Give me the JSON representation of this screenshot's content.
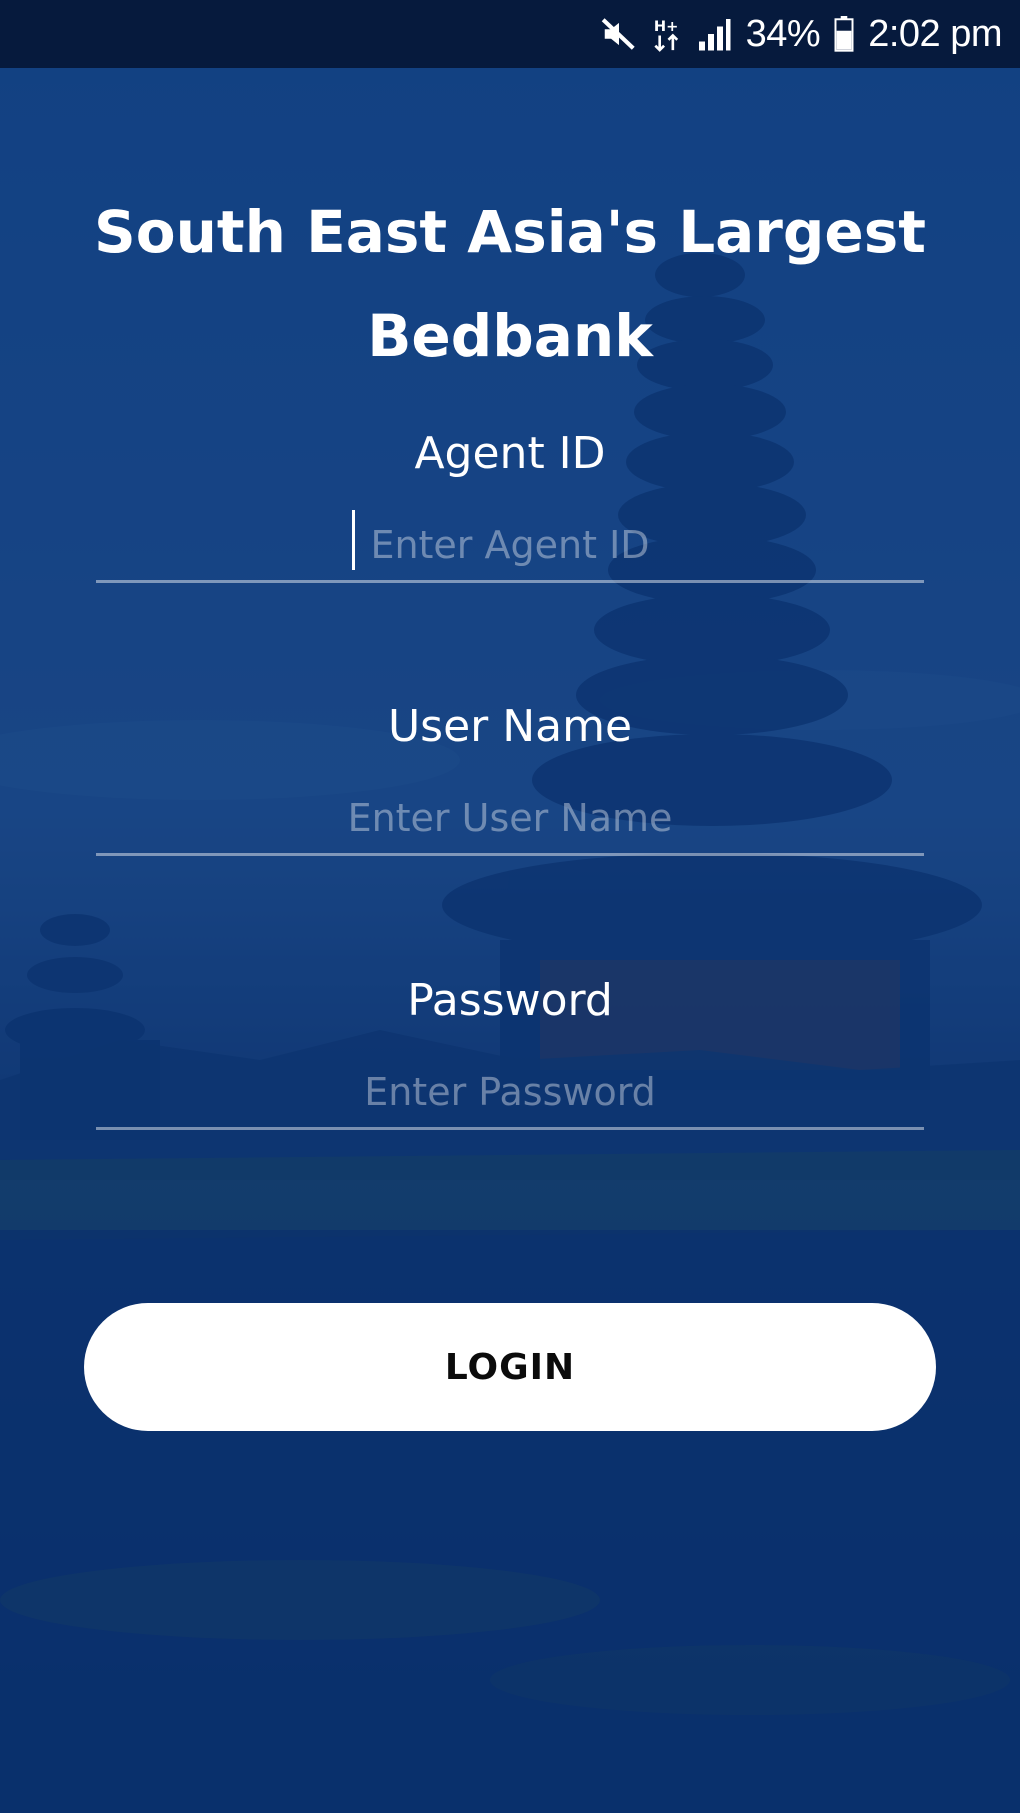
{
  "status_bar": {
    "battery": "34%",
    "time": "2:02 pm",
    "icons": [
      "mute-icon",
      "data-hplus-icon",
      "signal-icon",
      "battery-icon"
    ]
  },
  "login": {
    "title": "South East Asia's Largest Bedbank",
    "agent_id": {
      "label": "Agent ID",
      "placeholder": "Enter Agent ID",
      "value": ""
    },
    "user_name": {
      "label": "User Name",
      "placeholder": "Enter User Name",
      "value": ""
    },
    "password": {
      "label": "Password",
      "placeholder": "Enter Password",
      "value": ""
    },
    "button_label": "LOGIN"
  },
  "colors": {
    "status_bar": "#061a3d",
    "background": "#0e3a78",
    "button": "#ffffff",
    "text": "#ffffff"
  }
}
